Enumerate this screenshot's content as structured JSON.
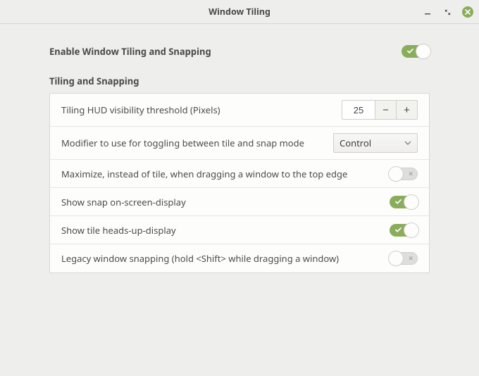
{
  "window": {
    "title": "Window Tiling"
  },
  "master": {
    "label": "Enable Window Tiling and Snapping",
    "enabled": true
  },
  "section": {
    "title": "Tiling and Snapping"
  },
  "rows": {
    "hud_threshold": {
      "label": "Tiling HUD visibility threshold (Pixels)",
      "value": "25"
    },
    "modifier": {
      "label": "Modifier to use for toggling between tile and snap mode",
      "value": "Control"
    },
    "maximize_top": {
      "label": "Maximize, instead of tile, when dragging a window to the top edge",
      "on": false
    },
    "snap_osd": {
      "label": "Show snap on-screen-display",
      "on": true
    },
    "tile_hud": {
      "label": "Show tile heads-up-display",
      "on": true
    },
    "legacy": {
      "label": "Legacy window snapping (hold <Shift> while dragging a window)",
      "on": false
    }
  },
  "colors": {
    "accent": "#8aad5b"
  }
}
